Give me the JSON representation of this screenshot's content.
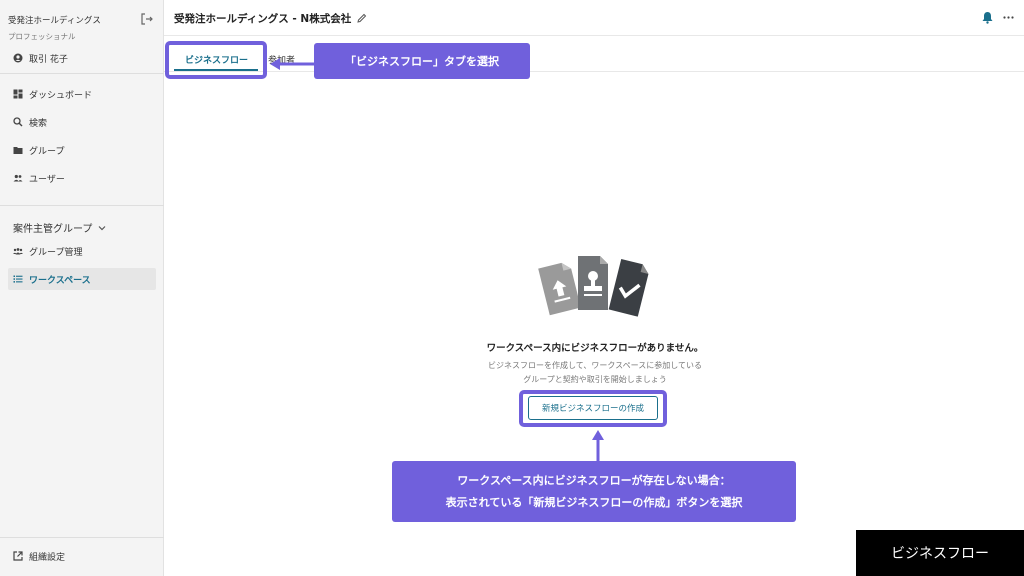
{
  "sidebar": {
    "org_name": "受発注ホールディングス",
    "plan": "プロフェッショナル",
    "user": "取引 花子",
    "items": [
      {
        "label": "ダッシュボード"
      },
      {
        "label": "検索"
      },
      {
        "label": "グループ"
      },
      {
        "label": "ユーザー"
      }
    ],
    "group_header": "案件主管グループ",
    "group_items": [
      {
        "label": "グループ管理"
      },
      {
        "label": "ワークスペース"
      }
    ],
    "settings": "組織設定"
  },
  "header": {
    "title": "受発注ホールディングス - N株式会社"
  },
  "tabs": [
    {
      "label": "ビジネスフロー"
    },
    {
      "label": "参加者"
    }
  ],
  "empty_state": {
    "title": "ワークスペース内にビジネスフローがありません。",
    "desc_line1": "ビジネスフローを作成して、ワークスペースに参加している",
    "desc_line2": "グループと契約や取引を開始しましょう",
    "button": "新規ビジネスフローの作成"
  },
  "annotations": {
    "callout_tab": "「ビジネスフロー」タブを選択",
    "callout_button_line1": "ワークスペース内にビジネスフローが存在しない場合：",
    "callout_button_line2": "表示されている「新規ビジネスフローの作成」ボタンを選択",
    "corner_label": "ビジネスフロー"
  },
  "colors": {
    "accent": "#1a6f8c",
    "annotation": "#7060dc"
  }
}
